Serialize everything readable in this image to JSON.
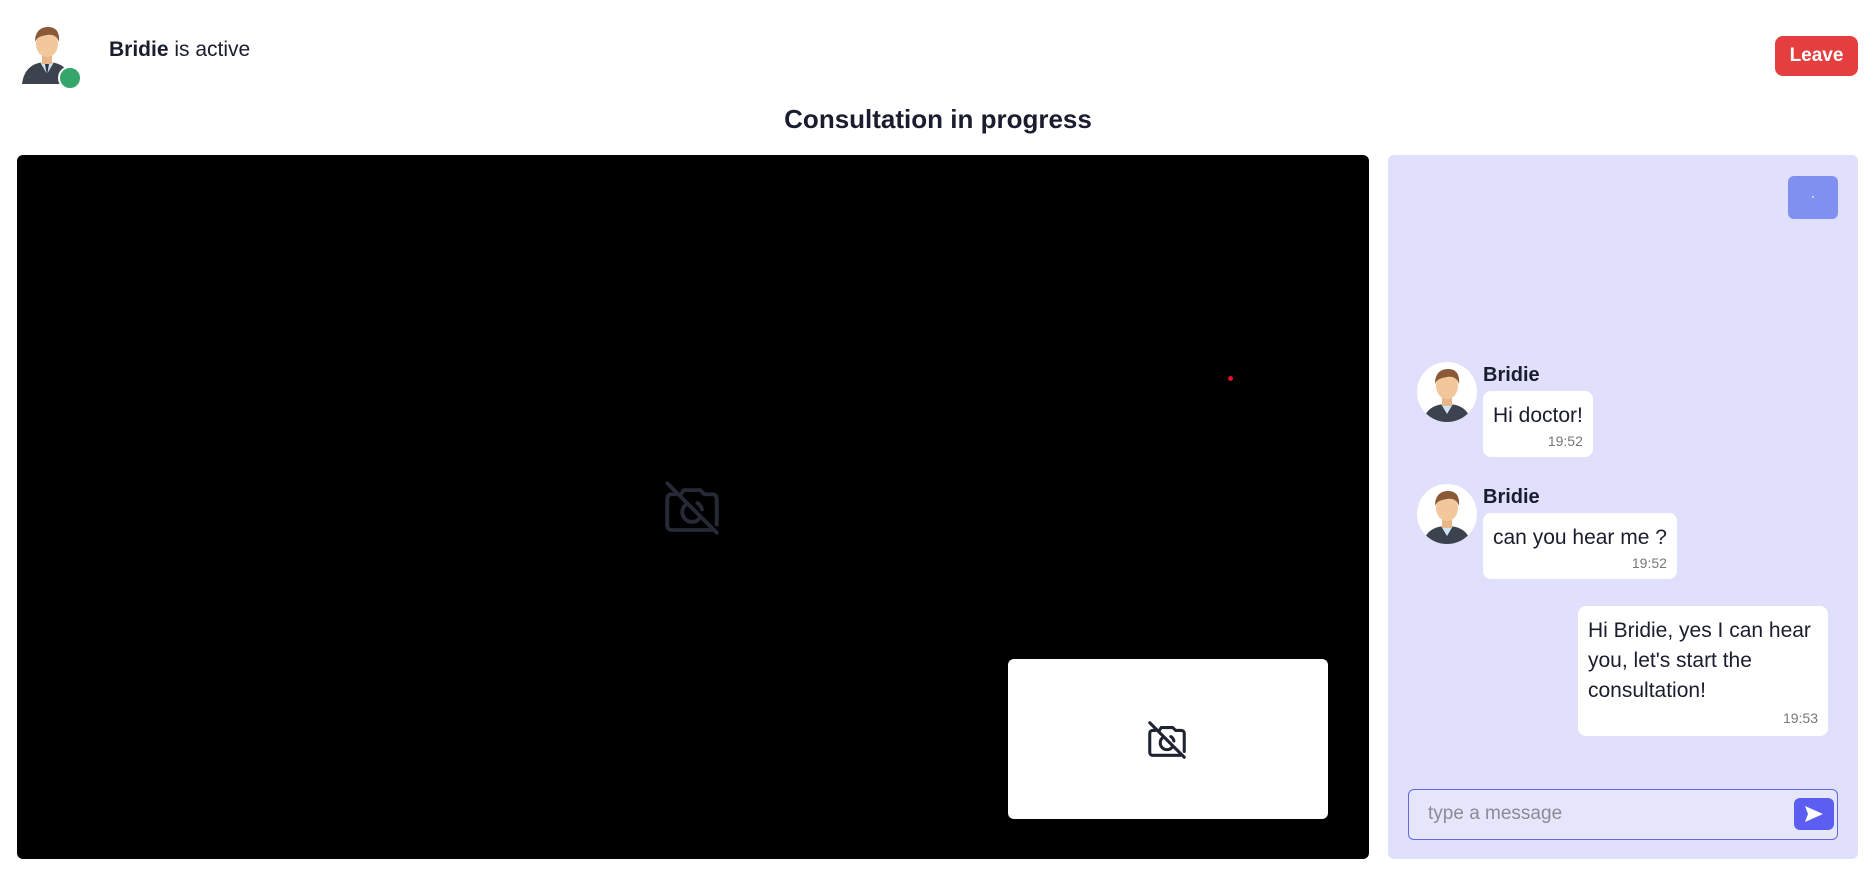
{
  "header": {
    "user_name": "Bridie",
    "status_suffix": " is active",
    "leave_label": "Leave"
  },
  "page_title": "Consultation in progress",
  "chat": {
    "messages": [
      {
        "sender": "Bridie",
        "text": "Hi doctor!",
        "time": "19:52"
      },
      {
        "sender": "Bridie",
        "text": "can you hear me ?",
        "time": "19:52"
      }
    ],
    "outgoing": {
      "text": "Hi Bridie, yes I can hear you, let's start the consultation!",
      "time": "19:53"
    },
    "input_placeholder": "type a message"
  },
  "colors": {
    "leave": "#e53e3e",
    "online": "#35a66b",
    "chat_bg": "#e0e0fc",
    "send": "#5b5ef0"
  },
  "icons": [
    "avatar-icon",
    "camera-off-icon",
    "send-icon"
  ]
}
